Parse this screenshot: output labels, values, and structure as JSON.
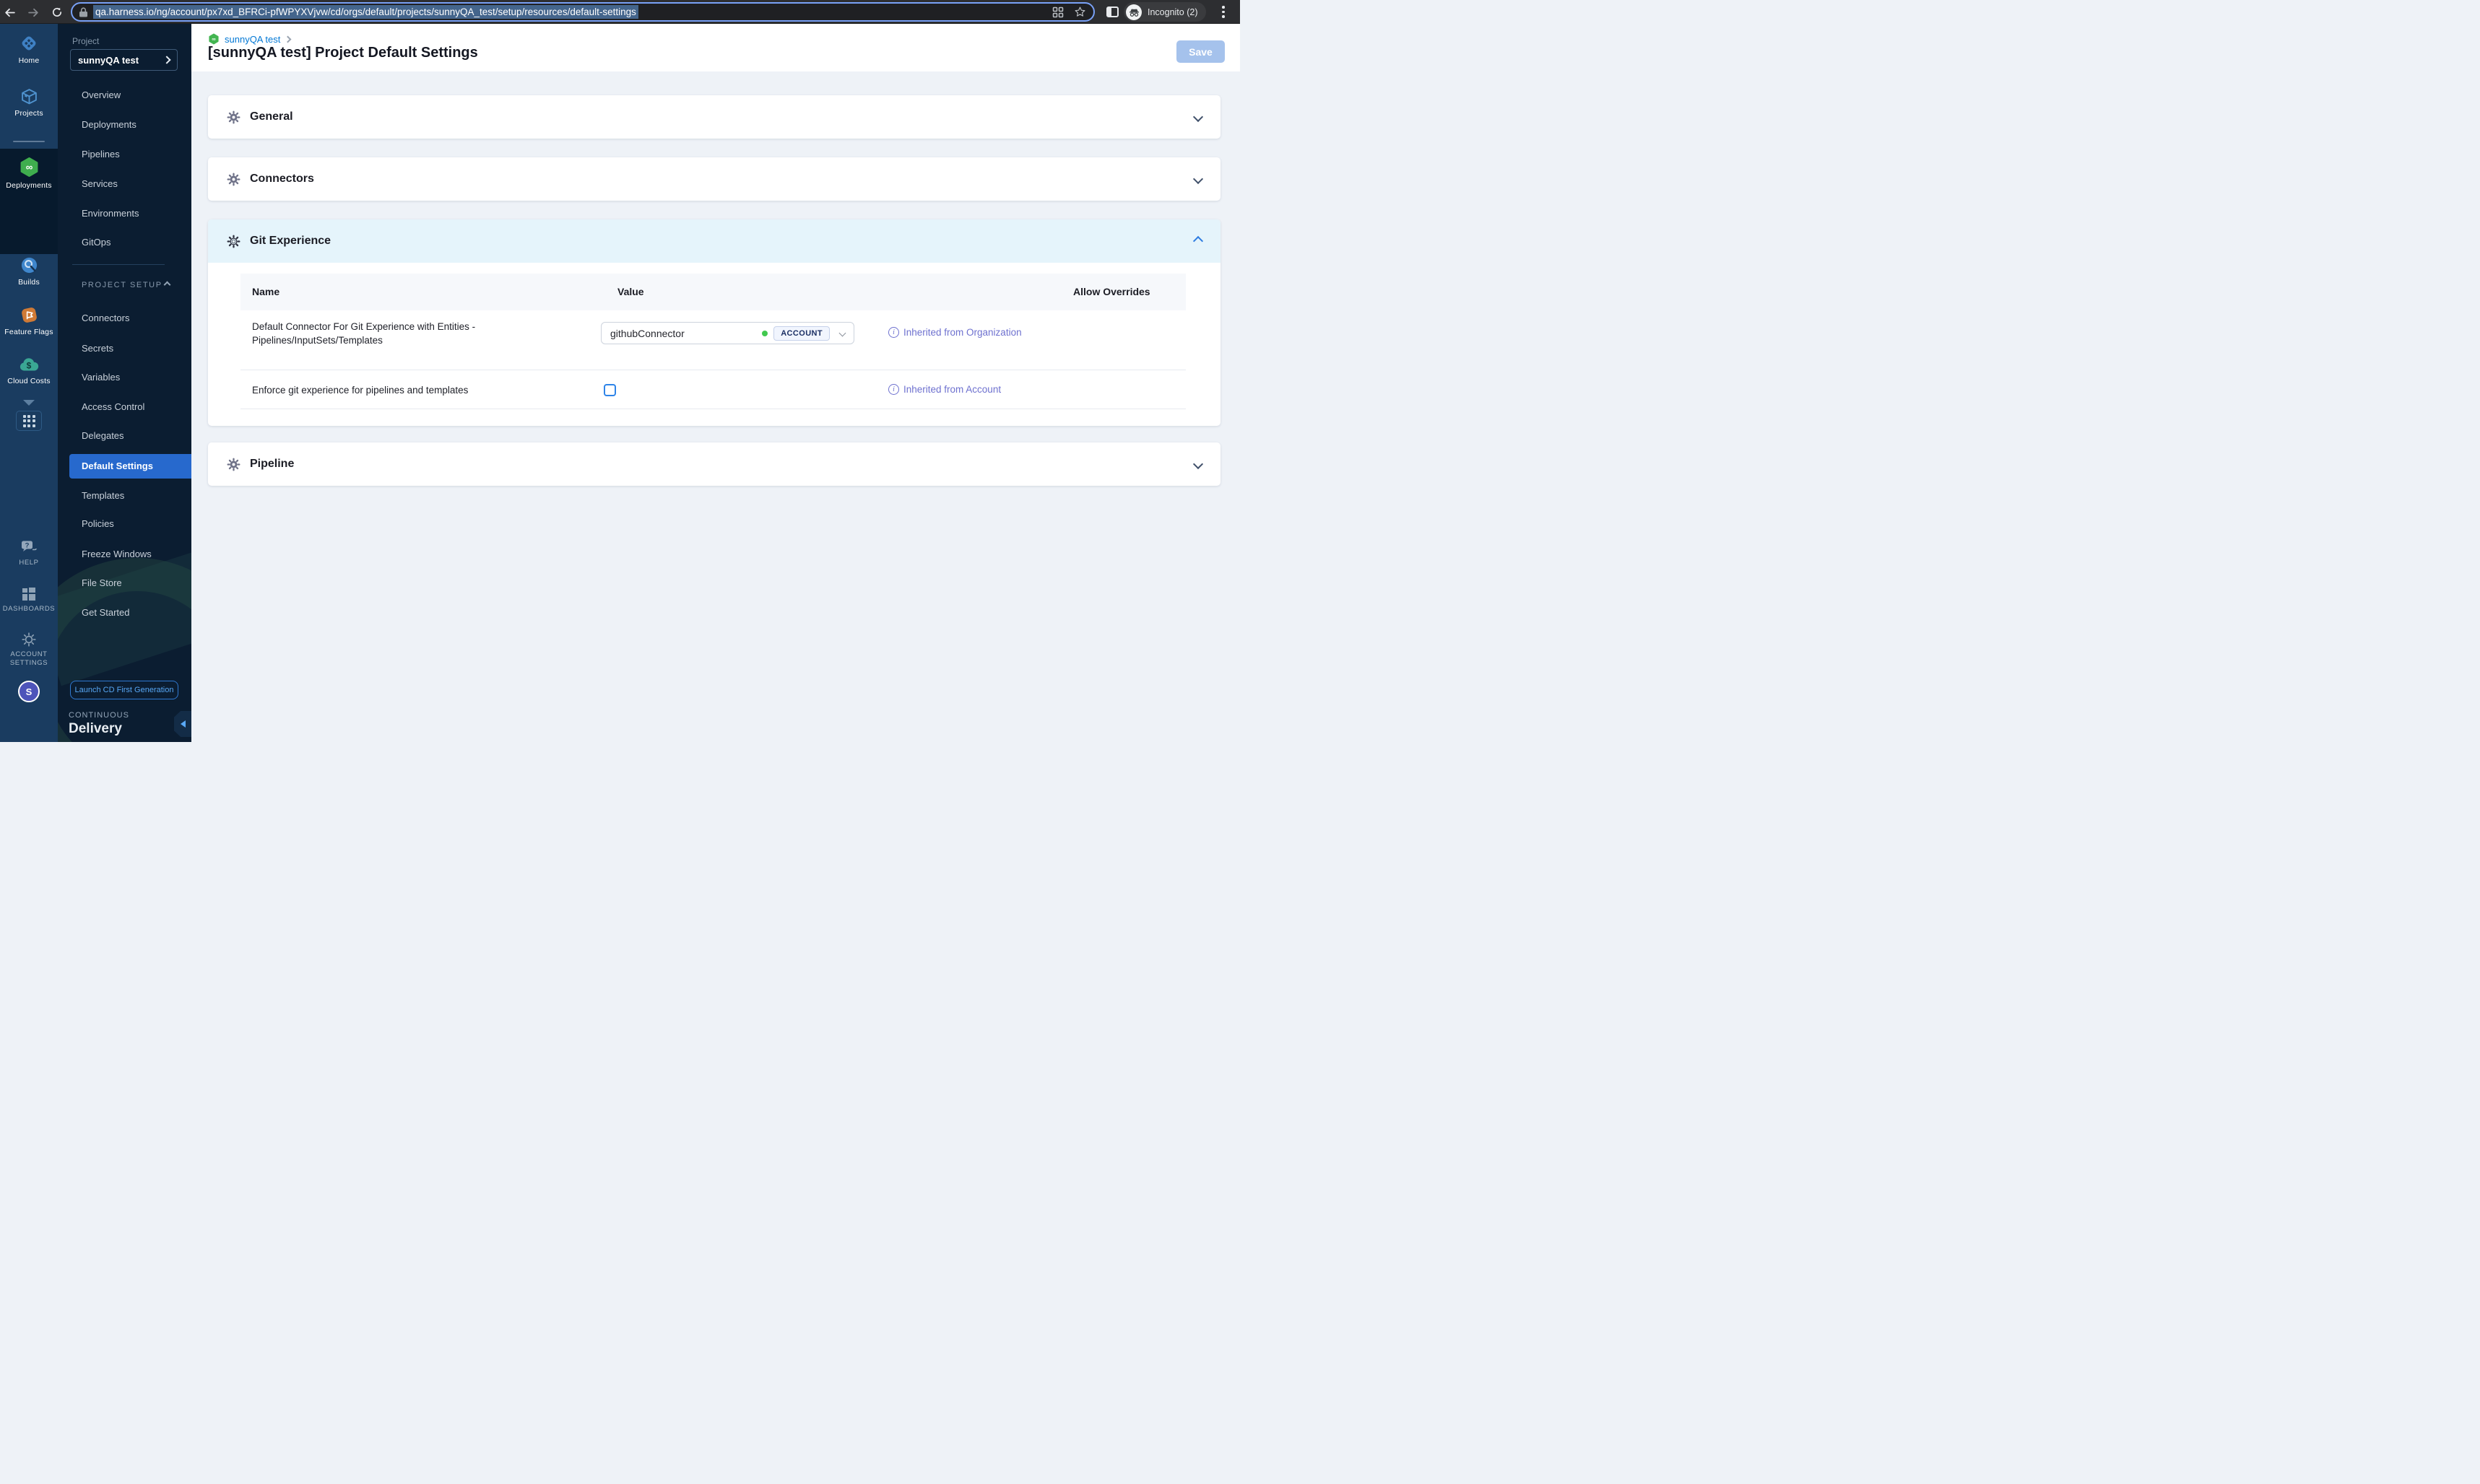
{
  "browser": {
    "url": "qa.harness.io/ng/account/px7xd_BFRCi-pfWPYXVjvw/cd/orgs/default/projects/sunnyQA_test/setup/resources/default-settings",
    "incognito_label": "Incognito (2)"
  },
  "module_sidebar": {
    "items": [
      {
        "label": "Home"
      },
      {
        "label": "Projects"
      },
      {
        "label": "Deployments"
      },
      {
        "label": "Builds"
      },
      {
        "label": "Feature Flags"
      },
      {
        "label": "Cloud Costs"
      }
    ],
    "bottom_items": [
      {
        "label": "HELP"
      },
      {
        "label": "DASHBOARDS"
      },
      {
        "label": "ACCOUNT SETTINGS"
      }
    ],
    "avatar_initial": "S"
  },
  "project_sidebar": {
    "section_label": "Project",
    "project_name": "sunnyQA test",
    "nav_items": [
      "Overview",
      "Deployments",
      "Pipelines",
      "Services",
      "Environments",
      "GitOps"
    ],
    "setup_section_label": "PROJECT SETUP",
    "setup_items": [
      "Connectors",
      "Secrets",
      "Variables",
      "Access Control",
      "Delegates",
      "Default Settings",
      "Templates",
      "Policies",
      "Freeze Windows",
      "File Store",
      "Get Started"
    ],
    "active_item": "Default Settings",
    "launch_button": "Launch CD First Generation",
    "brand_top": "CONTINUOUS",
    "brand_bottom": "Delivery"
  },
  "page": {
    "breadcrumb": "sunnyQA test",
    "title": "[sunnyQA test] Project Default Settings",
    "save_button": "Save"
  },
  "settings_sections": {
    "general": {
      "title": "General"
    },
    "connectors": {
      "title": "Connectors"
    },
    "git_experience": {
      "title": "Git Experience",
      "table": {
        "headers": [
          "Name",
          "Value",
          "Allow Overrides"
        ],
        "rows": [
          {
            "name": "Default Connector For Git Experience with Entities - Pipelines/InputSets/Templates",
            "value": "githubConnector",
            "scope": "ACCOUNT",
            "override": "Inherited from Organization"
          },
          {
            "name": "Enforce git experience for pipelines and templates",
            "checked": false,
            "override": "Inherited from Account"
          }
        ]
      }
    },
    "pipeline": {
      "title": "Pipeline"
    }
  },
  "colors": {
    "accent_blue": "#0278d5",
    "active_nav": "#2769cd",
    "inherit_link": "#6e71cf",
    "save_disabled": "#a5c2ec",
    "git_header_bg": "#e5f4fb",
    "scope_dot_green": "#42c94f"
  }
}
